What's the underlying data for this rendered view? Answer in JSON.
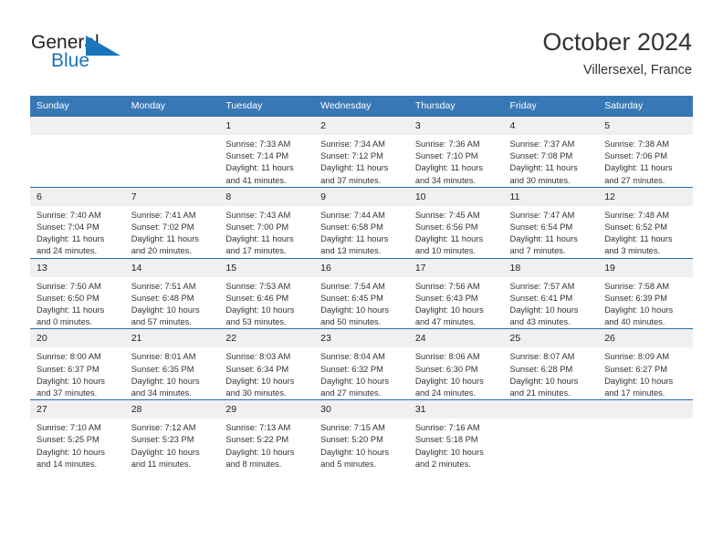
{
  "brand": {
    "name_part1": "General",
    "name_part2": "Blue",
    "logo_icon": "triangle-flag-icon",
    "color_dark": "#231f20",
    "color_blue": "#1b75bb"
  },
  "header": {
    "title": "October 2024",
    "subtitle": "Villersexel, France"
  },
  "theme": {
    "header_row_bg": "#3878b6",
    "row_separator": "#2b6cad",
    "daynum_bg": "#f0f0f0"
  },
  "weekdays": [
    "Sunday",
    "Monday",
    "Tuesday",
    "Wednesday",
    "Thursday",
    "Friday",
    "Saturday"
  ],
  "weeks": [
    [
      {
        "day": "",
        "sunrise": "",
        "sunset": "",
        "daylight_line1": "",
        "daylight_line2": ""
      },
      {
        "day": "",
        "sunrise": "",
        "sunset": "",
        "daylight_line1": "",
        "daylight_line2": ""
      },
      {
        "day": "1",
        "sunrise": "Sunrise: 7:33 AM",
        "sunset": "Sunset: 7:14 PM",
        "daylight_line1": "Daylight: 11 hours",
        "daylight_line2": "and 41 minutes."
      },
      {
        "day": "2",
        "sunrise": "Sunrise: 7:34 AM",
        "sunset": "Sunset: 7:12 PM",
        "daylight_line1": "Daylight: 11 hours",
        "daylight_line2": "and 37 minutes."
      },
      {
        "day": "3",
        "sunrise": "Sunrise: 7:36 AM",
        "sunset": "Sunset: 7:10 PM",
        "daylight_line1": "Daylight: 11 hours",
        "daylight_line2": "and 34 minutes."
      },
      {
        "day": "4",
        "sunrise": "Sunrise: 7:37 AM",
        "sunset": "Sunset: 7:08 PM",
        "daylight_line1": "Daylight: 11 hours",
        "daylight_line2": "and 30 minutes."
      },
      {
        "day": "5",
        "sunrise": "Sunrise: 7:38 AM",
        "sunset": "Sunset: 7:06 PM",
        "daylight_line1": "Daylight: 11 hours",
        "daylight_line2": "and 27 minutes."
      }
    ],
    [
      {
        "day": "6",
        "sunrise": "Sunrise: 7:40 AM",
        "sunset": "Sunset: 7:04 PM",
        "daylight_line1": "Daylight: 11 hours",
        "daylight_line2": "and 24 minutes."
      },
      {
        "day": "7",
        "sunrise": "Sunrise: 7:41 AM",
        "sunset": "Sunset: 7:02 PM",
        "daylight_line1": "Daylight: 11 hours",
        "daylight_line2": "and 20 minutes."
      },
      {
        "day": "8",
        "sunrise": "Sunrise: 7:43 AM",
        "sunset": "Sunset: 7:00 PM",
        "daylight_line1": "Daylight: 11 hours",
        "daylight_line2": "and 17 minutes."
      },
      {
        "day": "9",
        "sunrise": "Sunrise: 7:44 AM",
        "sunset": "Sunset: 6:58 PM",
        "daylight_line1": "Daylight: 11 hours",
        "daylight_line2": "and 13 minutes."
      },
      {
        "day": "10",
        "sunrise": "Sunrise: 7:45 AM",
        "sunset": "Sunset: 6:56 PM",
        "daylight_line1": "Daylight: 11 hours",
        "daylight_line2": "and 10 minutes."
      },
      {
        "day": "11",
        "sunrise": "Sunrise: 7:47 AM",
        "sunset": "Sunset: 6:54 PM",
        "daylight_line1": "Daylight: 11 hours",
        "daylight_line2": "and 7 minutes."
      },
      {
        "day": "12",
        "sunrise": "Sunrise: 7:48 AM",
        "sunset": "Sunset: 6:52 PM",
        "daylight_line1": "Daylight: 11 hours",
        "daylight_line2": "and 3 minutes."
      }
    ],
    [
      {
        "day": "13",
        "sunrise": "Sunrise: 7:50 AM",
        "sunset": "Sunset: 6:50 PM",
        "daylight_line1": "Daylight: 11 hours",
        "daylight_line2": "and 0 minutes."
      },
      {
        "day": "14",
        "sunrise": "Sunrise: 7:51 AM",
        "sunset": "Sunset: 6:48 PM",
        "daylight_line1": "Daylight: 10 hours",
        "daylight_line2": "and 57 minutes."
      },
      {
        "day": "15",
        "sunrise": "Sunrise: 7:53 AM",
        "sunset": "Sunset: 6:46 PM",
        "daylight_line1": "Daylight: 10 hours",
        "daylight_line2": "and 53 minutes."
      },
      {
        "day": "16",
        "sunrise": "Sunrise: 7:54 AM",
        "sunset": "Sunset: 6:45 PM",
        "daylight_line1": "Daylight: 10 hours",
        "daylight_line2": "and 50 minutes."
      },
      {
        "day": "17",
        "sunrise": "Sunrise: 7:56 AM",
        "sunset": "Sunset: 6:43 PM",
        "daylight_line1": "Daylight: 10 hours",
        "daylight_line2": "and 47 minutes."
      },
      {
        "day": "18",
        "sunrise": "Sunrise: 7:57 AM",
        "sunset": "Sunset: 6:41 PM",
        "daylight_line1": "Daylight: 10 hours",
        "daylight_line2": "and 43 minutes."
      },
      {
        "day": "19",
        "sunrise": "Sunrise: 7:58 AM",
        "sunset": "Sunset: 6:39 PM",
        "daylight_line1": "Daylight: 10 hours",
        "daylight_line2": "and 40 minutes."
      }
    ],
    [
      {
        "day": "20",
        "sunrise": "Sunrise: 8:00 AM",
        "sunset": "Sunset: 6:37 PM",
        "daylight_line1": "Daylight: 10 hours",
        "daylight_line2": "and 37 minutes."
      },
      {
        "day": "21",
        "sunrise": "Sunrise: 8:01 AM",
        "sunset": "Sunset: 6:35 PM",
        "daylight_line1": "Daylight: 10 hours",
        "daylight_line2": "and 34 minutes."
      },
      {
        "day": "22",
        "sunrise": "Sunrise: 8:03 AM",
        "sunset": "Sunset: 6:34 PM",
        "daylight_line1": "Daylight: 10 hours",
        "daylight_line2": "and 30 minutes."
      },
      {
        "day": "23",
        "sunrise": "Sunrise: 8:04 AM",
        "sunset": "Sunset: 6:32 PM",
        "daylight_line1": "Daylight: 10 hours",
        "daylight_line2": "and 27 minutes."
      },
      {
        "day": "24",
        "sunrise": "Sunrise: 8:06 AM",
        "sunset": "Sunset: 6:30 PM",
        "daylight_line1": "Daylight: 10 hours",
        "daylight_line2": "and 24 minutes."
      },
      {
        "day": "25",
        "sunrise": "Sunrise: 8:07 AM",
        "sunset": "Sunset: 6:28 PM",
        "daylight_line1": "Daylight: 10 hours",
        "daylight_line2": "and 21 minutes."
      },
      {
        "day": "26",
        "sunrise": "Sunrise: 8:09 AM",
        "sunset": "Sunset: 6:27 PM",
        "daylight_line1": "Daylight: 10 hours",
        "daylight_line2": "and 17 minutes."
      }
    ],
    [
      {
        "day": "27",
        "sunrise": "Sunrise: 7:10 AM",
        "sunset": "Sunset: 5:25 PM",
        "daylight_line1": "Daylight: 10 hours",
        "daylight_line2": "and 14 minutes."
      },
      {
        "day": "28",
        "sunrise": "Sunrise: 7:12 AM",
        "sunset": "Sunset: 5:23 PM",
        "daylight_line1": "Daylight: 10 hours",
        "daylight_line2": "and 11 minutes."
      },
      {
        "day": "29",
        "sunrise": "Sunrise: 7:13 AM",
        "sunset": "Sunset: 5:22 PM",
        "daylight_line1": "Daylight: 10 hours",
        "daylight_line2": "and 8 minutes."
      },
      {
        "day": "30",
        "sunrise": "Sunrise: 7:15 AM",
        "sunset": "Sunset: 5:20 PM",
        "daylight_line1": "Daylight: 10 hours",
        "daylight_line2": "and 5 minutes."
      },
      {
        "day": "31",
        "sunrise": "Sunrise: 7:16 AM",
        "sunset": "Sunset: 5:18 PM",
        "daylight_line1": "Daylight: 10 hours",
        "daylight_line2": "and 2 minutes."
      },
      {
        "day": "",
        "sunrise": "",
        "sunset": "",
        "daylight_line1": "",
        "daylight_line2": ""
      },
      {
        "day": "",
        "sunrise": "",
        "sunset": "",
        "daylight_line1": "",
        "daylight_line2": ""
      }
    ]
  ]
}
